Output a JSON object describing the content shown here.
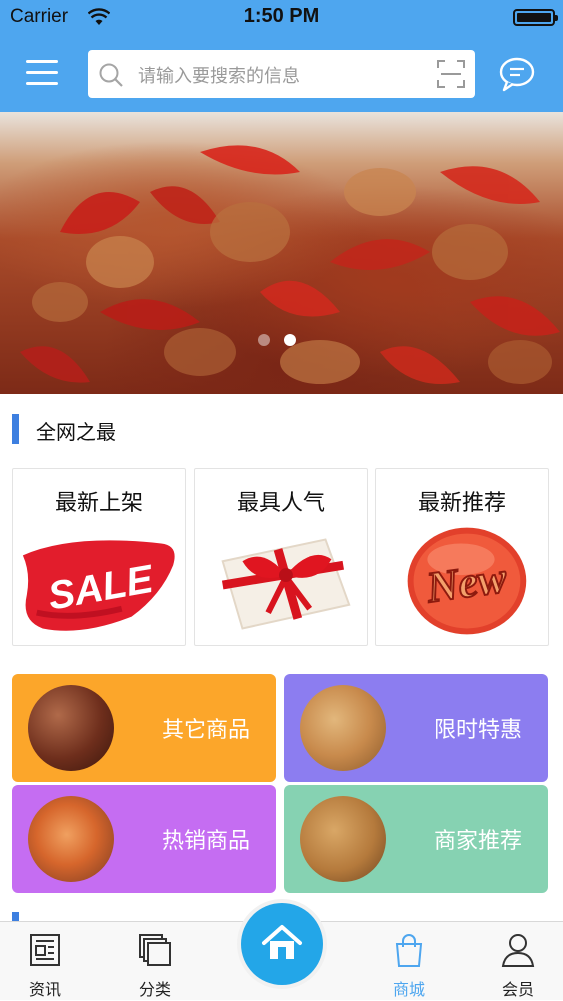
{
  "status_bar": {
    "carrier": "Carrier",
    "time": "1:50 PM"
  },
  "header": {
    "search_placeholder": "请输入要搜索的信息",
    "icons": {
      "menu": "menu-icon",
      "search": "search-icon",
      "scan": "scan-icon",
      "message": "message-icon"
    }
  },
  "banner": {
    "slide_count": 2,
    "active_slide": 2
  },
  "section": {
    "title": "全网之最"
  },
  "features": [
    {
      "title": "最新上架",
      "art": "SALE"
    },
    {
      "title": "最具人气",
      "art": "gift-icon"
    },
    {
      "title": "最新推荐",
      "art": "New"
    }
  ],
  "categories": [
    {
      "label": "其它商品",
      "color": "#fca62a"
    },
    {
      "label": "限时特惠",
      "color": "#8c7df0"
    },
    {
      "label": "热销商品",
      "color": "#c56df2"
    },
    {
      "label": "商家推荐",
      "color": "#86d2b2"
    }
  ],
  "tabbar": {
    "items": [
      {
        "label": "资讯",
        "icon": "news-icon",
        "active": false
      },
      {
        "label": "分类",
        "icon": "category-icon",
        "active": false
      },
      {
        "label": "",
        "icon": "home-icon",
        "active": false
      },
      {
        "label": "商城",
        "icon": "shop-bag-icon",
        "active": true
      },
      {
        "label": "会员",
        "icon": "member-icon",
        "active": false
      }
    ]
  },
  "colors": {
    "header_bg": "#4ea6ef",
    "accent": "#3d7fe0",
    "tab_active": "#4ea6ef",
    "home_button": "#23a6e8"
  }
}
